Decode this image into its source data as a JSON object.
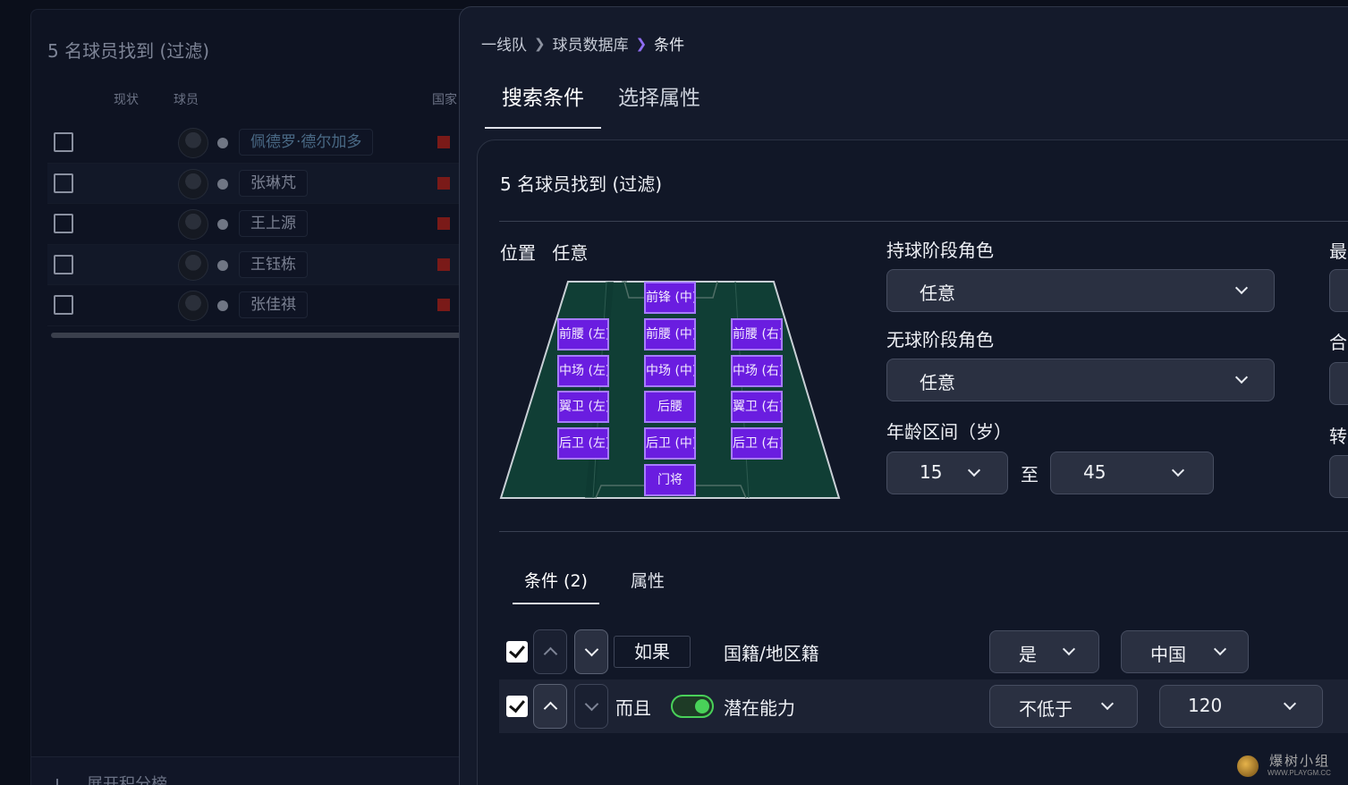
{
  "background_panel": {
    "found_text": "5  名球员找到 (过滤)",
    "columns": {
      "status": "现状",
      "player": "球员",
      "nation": "国家"
    },
    "players": [
      "佩德罗·德尔加多",
      "张琳芃",
      "王上源",
      "王钰栋",
      "张佳祺"
    ],
    "footer_label": "展开积分榜"
  },
  "breadcrumb": {
    "items": [
      "一线队",
      "球员数据库",
      "条件"
    ]
  },
  "tabs": [
    "搜索条件",
    "选择属性"
  ],
  "filter": {
    "found_text": "5  名球员找到 (过滤)",
    "position_label": "位置",
    "position_value": "任意",
    "positions": {
      "st_c": "前锋 (中)",
      "am_l": "前腰 (左)",
      "am_c": "前腰 (中)",
      "am_r": "前腰 (右)",
      "m_l": "中场 (左)",
      "m_c": "中场 (中)",
      "m_r": "中场 (右)",
      "wb_l": "翼卫 (左)",
      "dm": "后腰",
      "wb_r": "翼卫 (右)",
      "d_l": "后卫 (左)",
      "d_c": "后卫 (中)",
      "d_r": "后卫 (右)",
      "gk": "门将"
    },
    "in_possession_label": "持球阶段角色",
    "in_possession_value": "任意",
    "out_possession_label": "无球阶段角色",
    "out_possession_value": "任意",
    "age_label": "年龄区间（岁）",
    "age_min": "15",
    "age_to": "至",
    "age_max": "45",
    "right_labels": [
      "最",
      "合",
      "转"
    ]
  },
  "conditions": {
    "tabs": [
      "条件 (2)",
      "属性"
    ],
    "rows": [
      {
        "keyword": "如果",
        "field": "国籍/地区籍",
        "operator": "是",
        "value": "中国"
      },
      {
        "keyword": "而且",
        "field": "潜在能力",
        "operator": "不低于",
        "value": "120"
      }
    ]
  },
  "watermark": {
    "title": "爆树小组",
    "url": "WWW.PLAYGM.CC"
  },
  "colors": {
    "accent": "#8f6df2",
    "position_button": "#6a1de0",
    "pitch": "#103e35",
    "toggle_on": "#49d159"
  }
}
